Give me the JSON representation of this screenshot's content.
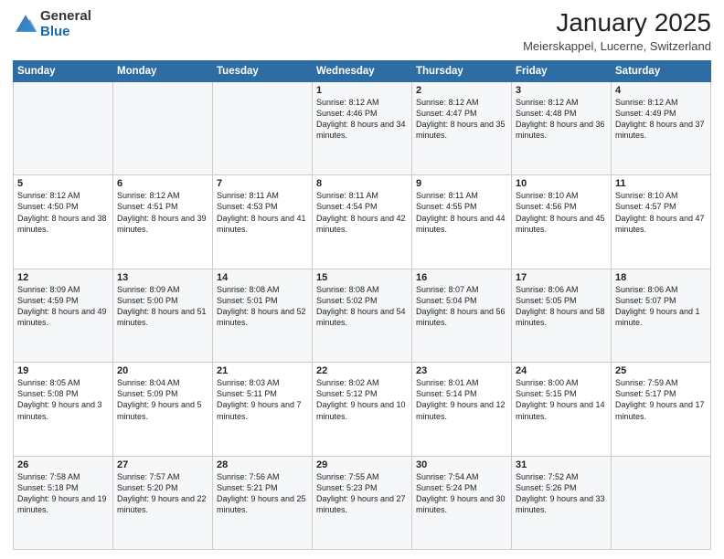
{
  "logo": {
    "general": "General",
    "blue": "Blue"
  },
  "header": {
    "title": "January 2025",
    "location": "Meierskappel, Lucerne, Switzerland"
  },
  "weekdays": [
    "Sunday",
    "Monday",
    "Tuesday",
    "Wednesday",
    "Thursday",
    "Friday",
    "Saturday"
  ],
  "weeks": [
    [
      {
        "day": "",
        "text": ""
      },
      {
        "day": "",
        "text": ""
      },
      {
        "day": "",
        "text": ""
      },
      {
        "day": "1",
        "text": "Sunrise: 8:12 AM\nSunset: 4:46 PM\nDaylight: 8 hours and 34 minutes."
      },
      {
        "day": "2",
        "text": "Sunrise: 8:12 AM\nSunset: 4:47 PM\nDaylight: 8 hours and 35 minutes."
      },
      {
        "day": "3",
        "text": "Sunrise: 8:12 AM\nSunset: 4:48 PM\nDaylight: 8 hours and 36 minutes."
      },
      {
        "day": "4",
        "text": "Sunrise: 8:12 AM\nSunset: 4:49 PM\nDaylight: 8 hours and 37 minutes."
      }
    ],
    [
      {
        "day": "5",
        "text": "Sunrise: 8:12 AM\nSunset: 4:50 PM\nDaylight: 8 hours and 38 minutes."
      },
      {
        "day": "6",
        "text": "Sunrise: 8:12 AM\nSunset: 4:51 PM\nDaylight: 8 hours and 39 minutes."
      },
      {
        "day": "7",
        "text": "Sunrise: 8:11 AM\nSunset: 4:53 PM\nDaylight: 8 hours and 41 minutes."
      },
      {
        "day": "8",
        "text": "Sunrise: 8:11 AM\nSunset: 4:54 PM\nDaylight: 8 hours and 42 minutes."
      },
      {
        "day": "9",
        "text": "Sunrise: 8:11 AM\nSunset: 4:55 PM\nDaylight: 8 hours and 44 minutes."
      },
      {
        "day": "10",
        "text": "Sunrise: 8:10 AM\nSunset: 4:56 PM\nDaylight: 8 hours and 45 minutes."
      },
      {
        "day": "11",
        "text": "Sunrise: 8:10 AM\nSunset: 4:57 PM\nDaylight: 8 hours and 47 minutes."
      }
    ],
    [
      {
        "day": "12",
        "text": "Sunrise: 8:09 AM\nSunset: 4:59 PM\nDaylight: 8 hours and 49 minutes."
      },
      {
        "day": "13",
        "text": "Sunrise: 8:09 AM\nSunset: 5:00 PM\nDaylight: 8 hours and 51 minutes."
      },
      {
        "day": "14",
        "text": "Sunrise: 8:08 AM\nSunset: 5:01 PM\nDaylight: 8 hours and 52 minutes."
      },
      {
        "day": "15",
        "text": "Sunrise: 8:08 AM\nSunset: 5:02 PM\nDaylight: 8 hours and 54 minutes."
      },
      {
        "day": "16",
        "text": "Sunrise: 8:07 AM\nSunset: 5:04 PM\nDaylight: 8 hours and 56 minutes."
      },
      {
        "day": "17",
        "text": "Sunrise: 8:06 AM\nSunset: 5:05 PM\nDaylight: 8 hours and 58 minutes."
      },
      {
        "day": "18",
        "text": "Sunrise: 8:06 AM\nSunset: 5:07 PM\nDaylight: 9 hours and 1 minute."
      }
    ],
    [
      {
        "day": "19",
        "text": "Sunrise: 8:05 AM\nSunset: 5:08 PM\nDaylight: 9 hours and 3 minutes."
      },
      {
        "day": "20",
        "text": "Sunrise: 8:04 AM\nSunset: 5:09 PM\nDaylight: 9 hours and 5 minutes."
      },
      {
        "day": "21",
        "text": "Sunrise: 8:03 AM\nSunset: 5:11 PM\nDaylight: 9 hours and 7 minutes."
      },
      {
        "day": "22",
        "text": "Sunrise: 8:02 AM\nSunset: 5:12 PM\nDaylight: 9 hours and 10 minutes."
      },
      {
        "day": "23",
        "text": "Sunrise: 8:01 AM\nSunset: 5:14 PM\nDaylight: 9 hours and 12 minutes."
      },
      {
        "day": "24",
        "text": "Sunrise: 8:00 AM\nSunset: 5:15 PM\nDaylight: 9 hours and 14 minutes."
      },
      {
        "day": "25",
        "text": "Sunrise: 7:59 AM\nSunset: 5:17 PM\nDaylight: 9 hours and 17 minutes."
      }
    ],
    [
      {
        "day": "26",
        "text": "Sunrise: 7:58 AM\nSunset: 5:18 PM\nDaylight: 9 hours and 19 minutes."
      },
      {
        "day": "27",
        "text": "Sunrise: 7:57 AM\nSunset: 5:20 PM\nDaylight: 9 hours and 22 minutes."
      },
      {
        "day": "28",
        "text": "Sunrise: 7:56 AM\nSunset: 5:21 PM\nDaylight: 9 hours and 25 minutes."
      },
      {
        "day": "29",
        "text": "Sunrise: 7:55 AM\nSunset: 5:23 PM\nDaylight: 9 hours and 27 minutes."
      },
      {
        "day": "30",
        "text": "Sunrise: 7:54 AM\nSunset: 5:24 PM\nDaylight: 9 hours and 30 minutes."
      },
      {
        "day": "31",
        "text": "Sunrise: 7:52 AM\nSunset: 5:26 PM\nDaylight: 9 hours and 33 minutes."
      },
      {
        "day": "",
        "text": ""
      }
    ]
  ]
}
